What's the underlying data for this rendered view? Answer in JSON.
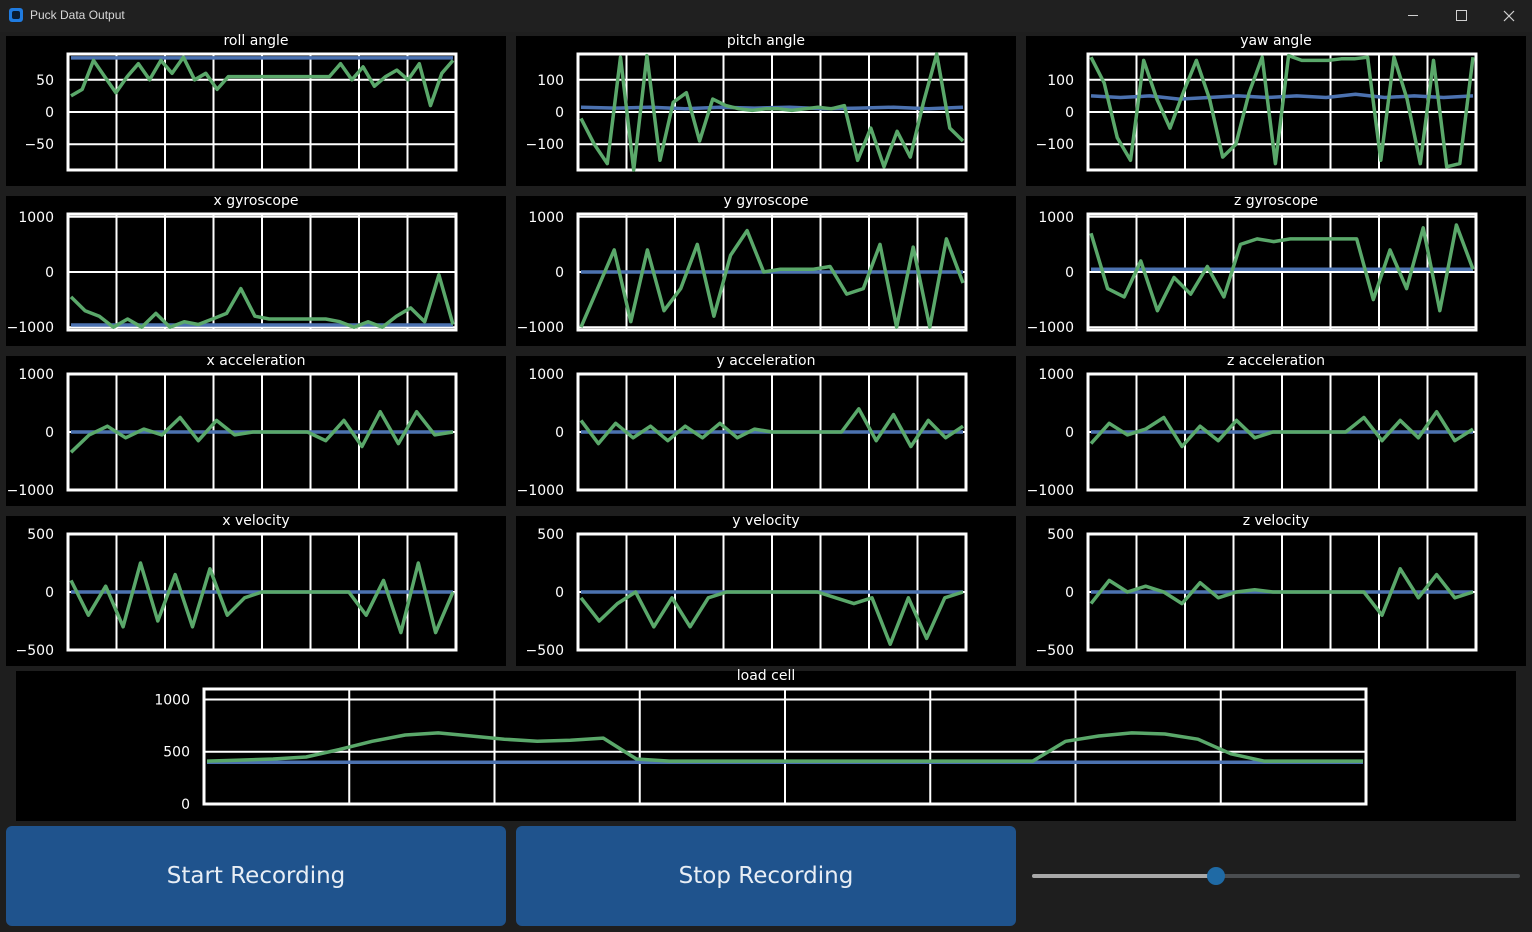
{
  "window": {
    "title": "Puck Data Output"
  },
  "colors": {
    "signal": "#5aa86a",
    "baseline": "#4c72b0",
    "button": "#1f538d",
    "slider_accent": "#1f6aa5"
  },
  "controls": {
    "start_label": "Start Recording",
    "stop_label": "Stop Recording",
    "slider_value": 0.38
  },
  "chart_data": [
    {
      "type": "line",
      "title": "roll angle",
      "ylim": [
        -90,
        90
      ],
      "yticks": [
        50,
        0,
        -50
      ],
      "series": [
        {
          "values": [
            84,
            84,
            84,
            84,
            84,
            84,
            84,
            84,
            84,
            84
          ]
        },
        {
          "values": [
            25,
            35,
            80,
            55,
            30,
            55,
            75,
            50,
            80,
            60,
            85,
            50,
            60,
            35,
            55,
            55,
            55,
            55,
            55,
            55,
            55,
            55,
            55,
            55,
            75,
            50,
            70,
            40,
            55,
            65,
            50,
            75,
            10,
            60,
            80
          ]
        }
      ]
    },
    {
      "type": "line",
      "title": "pitch angle",
      "ylim": [
        -180,
        180
      ],
      "yticks": [
        100,
        0,
        -100
      ],
      "series": [
        {
          "values": [
            15,
            12,
            15,
            10,
            15,
            12,
            15,
            10,
            12,
            15,
            10,
            15
          ]
        },
        {
          "values": [
            -20,
            -100,
            -160,
            170,
            -180,
            175,
            -150,
            30,
            60,
            -90,
            40,
            20,
            10,
            5,
            10,
            10,
            5,
            10,
            15,
            10,
            20,
            -150,
            -50,
            -170,
            -60,
            -140,
            30,
            180,
            -50,
            -90
          ]
        }
      ]
    },
    {
      "type": "line",
      "title": "yaw angle",
      "ylim": [
        -180,
        180
      ],
      "yticks": [
        100,
        0,
        -100
      ],
      "series": [
        {
          "values": [
            50,
            45,
            50,
            40,
            45,
            50,
            45,
            50,
            45,
            55,
            45,
            50,
            45,
            50
          ]
        },
        {
          "values": [
            170,
            90,
            -80,
            -150,
            160,
            40,
            -50,
            60,
            160,
            40,
            -140,
            -100,
            60,
            170,
            -160,
            175,
            160,
            160,
            160,
            165,
            165,
            170,
            -150,
            170,
            40,
            -160,
            160,
            -170,
            -160,
            170
          ]
        }
      ]
    },
    {
      "type": "line",
      "title": "x gyroscope",
      "ylim": [
        -1050,
        1050
      ],
      "yticks": [
        1000,
        0,
        -1000
      ],
      "series": [
        {
          "values": [
            -960,
            -960,
            -960,
            -960,
            -960,
            -960,
            -960,
            -960
          ]
        },
        {
          "values": [
            -450,
            -700,
            -800,
            -1000,
            -850,
            -1000,
            -750,
            -1000,
            -900,
            -950,
            -850,
            -750,
            -300,
            -800,
            -850,
            -850,
            -850,
            -850,
            -850,
            -900,
            -1000,
            -900,
            -1000,
            -800,
            -650,
            -900,
            -50,
            -950
          ]
        }
      ]
    },
    {
      "type": "line",
      "title": "y gyroscope",
      "ylim": [
        -1050,
        1050
      ],
      "yticks": [
        1000,
        0,
        -1000
      ],
      "series": [
        {
          "values": [
            0,
            0,
            0,
            0,
            0,
            0,
            0,
            0
          ]
        },
        {
          "values": [
            -1000,
            -300,
            400,
            -900,
            400,
            -700,
            -300,
            500,
            -800,
            300,
            750,
            0,
            50,
            50,
            50,
            100,
            -400,
            -300,
            500,
            -1000,
            450,
            -1000,
            600,
            -200
          ]
        }
      ]
    },
    {
      "type": "line",
      "title": "z gyroscope",
      "ylim": [
        -1050,
        1050
      ],
      "yticks": [
        1000,
        0,
        -1000
      ],
      "series": [
        {
          "values": [
            50,
            50,
            50,
            50,
            50,
            50,
            50,
            50
          ]
        },
        {
          "values": [
            700,
            -300,
            -450,
            200,
            -700,
            -100,
            -400,
            100,
            -450,
            500,
            600,
            550,
            600,
            600,
            600,
            600,
            600,
            -500,
            400,
            -300,
            800,
            -700,
            850,
            50
          ]
        }
      ]
    },
    {
      "type": "line",
      "title": "x acceleration",
      "ylim": [
        -1000,
        1000
      ],
      "yticks": [
        1000,
        0,
        -1000
      ],
      "series": [
        {
          "values": [
            0,
            0,
            0,
            0,
            0,
            0,
            0,
            0
          ]
        },
        {
          "values": [
            -350,
            -50,
            100,
            -100,
            50,
            -50,
            250,
            -150,
            200,
            -50,
            0,
            0,
            0,
            0,
            -150,
            200,
            -250,
            350,
            -200,
            350,
            -50,
            0
          ]
        }
      ]
    },
    {
      "type": "line",
      "title": "y acceleration",
      "ylim": [
        -1000,
        1000
      ],
      "yticks": [
        1000,
        0,
        -1000
      ],
      "series": [
        {
          "values": [
            0,
            0,
            0,
            0,
            0,
            0,
            0,
            0
          ]
        },
        {
          "values": [
            200,
            -200,
            150,
            -100,
            100,
            -150,
            100,
            -100,
            150,
            -100,
            50,
            0,
            0,
            0,
            0,
            0,
            400,
            -150,
            300,
            -250,
            200,
            -100,
            100
          ]
        }
      ]
    },
    {
      "type": "line",
      "title": "z acceleration",
      "ylim": [
        -1000,
        1000
      ],
      "yticks": [
        1000,
        0,
        -1000
      ],
      "series": [
        {
          "values": [
            0,
            0,
            0,
            0,
            0,
            0,
            0,
            0
          ]
        },
        {
          "values": [
            -200,
            150,
            -50,
            50,
            250,
            -250,
            100,
            -150,
            200,
            -100,
            0,
            0,
            0,
            0,
            0,
            250,
            -150,
            200,
            -100,
            350,
            -150,
            50
          ]
        }
      ]
    },
    {
      "type": "line",
      "title": "x velocity",
      "ylim": [
        -500,
        500
      ],
      "yticks": [
        500,
        0,
        -500
      ],
      "series": [
        {
          "values": [
            0,
            0,
            0,
            0,
            0,
            0,
            0,
            0
          ]
        },
        {
          "values": [
            100,
            -200,
            50,
            -300,
            250,
            -250,
            150,
            -300,
            200,
            -200,
            -50,
            0,
            0,
            0,
            0,
            0,
            0,
            -200,
            100,
            -350,
            250,
            -350,
            0
          ]
        }
      ]
    },
    {
      "type": "line",
      "title": "y velocity",
      "ylim": [
        -500,
        500
      ],
      "yticks": [
        500,
        0,
        -500
      ],
      "series": [
        {
          "values": [
            0,
            0,
            0,
            0,
            0,
            0,
            0,
            0
          ]
        },
        {
          "values": [
            -50,
            -250,
            -100,
            0,
            -300,
            -50,
            -300,
            -50,
            0,
            0,
            0,
            0,
            0,
            0,
            -50,
            -100,
            -50,
            -450,
            -50,
            -400,
            -50,
            0
          ]
        }
      ]
    },
    {
      "type": "line",
      "title": "z velocity",
      "ylim": [
        -500,
        500
      ],
      "yticks": [
        500,
        0,
        -500
      ],
      "series": [
        {
          "values": [
            0,
            0,
            0,
            0,
            0,
            0,
            0,
            0
          ]
        },
        {
          "values": [
            -100,
            100,
            0,
            50,
            0,
            -100,
            80,
            -50,
            0,
            20,
            0,
            0,
            0,
            0,
            0,
            0,
            -200,
            200,
            -50,
            150,
            -50,
            0
          ]
        }
      ]
    },
    {
      "type": "line",
      "title": "load cell",
      "ylim": [
        0,
        1100
      ],
      "yticks": [
        1000,
        500,
        0
      ],
      "series": [
        {
          "values": [
            400,
            400,
            400,
            400,
            400,
            400,
            400,
            400
          ]
        },
        {
          "values": [
            410,
            420,
            430,
            450,
            520,
            600,
            660,
            680,
            650,
            620,
            600,
            610,
            630,
            430,
            410,
            410,
            410,
            410,
            410,
            410,
            410,
            410,
            410,
            410,
            410,
            410,
            600,
            650,
            680,
            670,
            620,
            480,
            410,
            410,
            410,
            410
          ]
        }
      ]
    }
  ]
}
